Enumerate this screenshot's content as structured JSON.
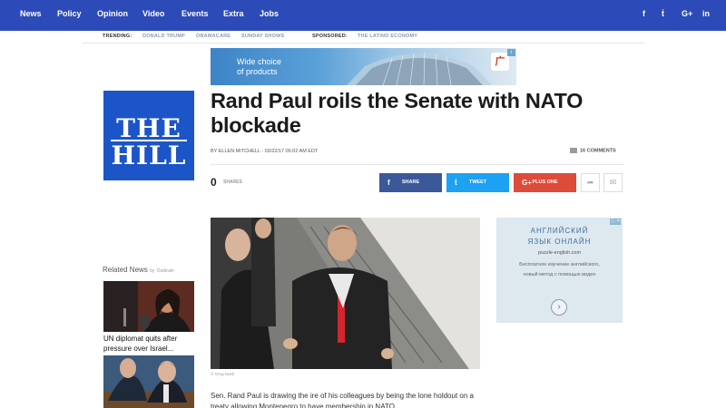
{
  "nav": {
    "items": [
      "News",
      "Policy",
      "Opinion",
      "Video",
      "Events",
      "Extra",
      "Jobs"
    ],
    "social": [
      {
        "icon": "facebook-icon",
        "glyph": "f"
      },
      {
        "icon": "twitter-icon",
        "glyph": "ṫ"
      },
      {
        "icon": "google-plus-icon",
        "glyph": "G+"
      },
      {
        "icon": "linkedin-icon",
        "glyph": "in"
      }
    ]
  },
  "trending": {
    "label": "TRENDING:",
    "links": [
      "DONALD TRUMP",
      "OBAMACARE",
      "SUNDAY SHOWS"
    ],
    "sponsored_label": "SPONSORED:",
    "sponsored_link": "THE LATINO ECONOMY"
  },
  "banner_ad": {
    "line1": "Wide choice",
    "line2": "of products",
    "logo_glyph": "广"
  },
  "logo": {
    "line1": "THE",
    "line2": "HILL"
  },
  "article": {
    "title": "Rand Paul roils the Senate with NATO blockade",
    "byline": "BY ELLEN MITCHELL - 03/22/17 06:02 AM EDT",
    "comments": "16 COMMENTS",
    "shares_count": "0",
    "shares_label": "SHARES",
    "photo_credit": "© Greg Nash",
    "text": "Sen. Rand Paul is drawing the ire of his colleagues by being the lone holdout on a treaty allowing Montenegro to have membership in NATO."
  },
  "share_buttons": [
    {
      "name": "facebook-share-button",
      "label": "SHARE",
      "glyph": "f",
      "color": "#3b5998"
    },
    {
      "name": "twitter-tweet-button",
      "label": "TWEET",
      "glyph": "ṫ",
      "color": "#1da1f2"
    },
    {
      "name": "google-plus-one-button",
      "label": "PLUS ONE",
      "glyph": "G+",
      "color": "#dd4b39"
    }
  ],
  "related": {
    "heading": "Related News",
    "by": "by",
    "provider": "Outbrain",
    "items": [
      {
        "title": "UN diplomat quits after pressure over Israel..."
      }
    ]
  },
  "right_ad": {
    "line1": "АНГЛИЙСКИЙ",
    "line2": "ЯЗЫК ОНЛАЙН",
    "url": "puzzle-english.com",
    "desc": "Бесплатное изучение английского, новый метод с помощью видео",
    "ad_chip": "ⓘ ✕"
  },
  "colors": {
    "nav": "#2c4bb8",
    "logo": "#1c55c8",
    "trend_link": "#8a99b8"
  }
}
